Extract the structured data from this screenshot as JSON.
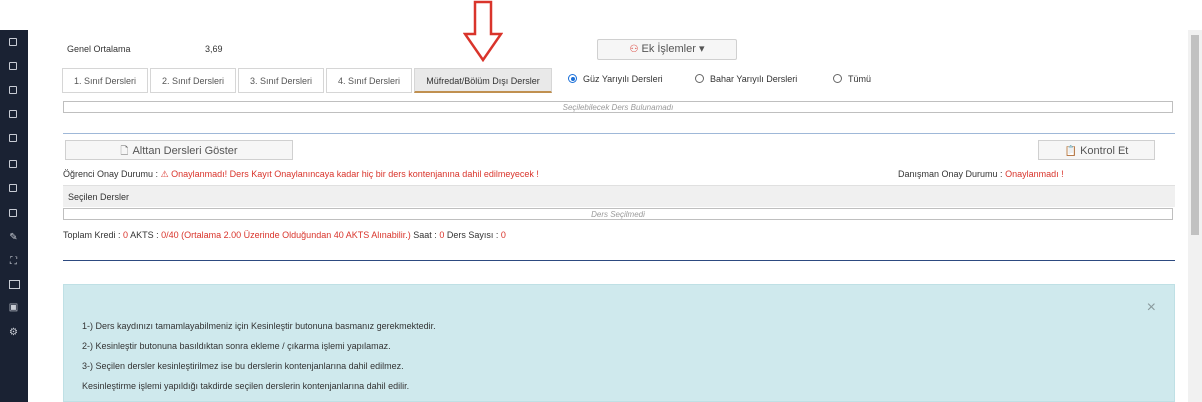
{
  "sidebar": {
    "icons": [
      "square-icon",
      "square-icon",
      "square-icon",
      "square-icon",
      "square-icon",
      "square-icon",
      "square-icon",
      "square-icon",
      "edit-icon",
      "sitemap-icon",
      "ats-icon",
      "id-card-icon",
      "cogs-icon"
    ]
  },
  "summary": {
    "gpa_label": "Genel Ortalama",
    "gpa_value": "3,69",
    "ek_islemler": "Ek İşlemler ▾"
  },
  "tabs": [
    {
      "label": "1. Sınıf Dersleri"
    },
    {
      "label": "2. Sınıf Dersleri"
    },
    {
      "label": "3. Sınıf Dersleri"
    },
    {
      "label": "4. Sınıf Dersleri"
    },
    {
      "label": "Müfredat/Bölüm Dışı Dersler"
    }
  ],
  "semester_filter": {
    "options": [
      "Güz Yarıyılı Dersleri",
      "Bahar Yarıyılı Dersleri",
      "Tümü"
    ],
    "selected": "Güz Yarıyılı Dersleri"
  },
  "available_courses_empty": "Seçilebilecek Ders Bulunamadı",
  "buttons": {
    "show_failed": "Alttan Dersleri Göster",
    "check": "Kontrol Et"
  },
  "approval": {
    "student_label": "Öğrenci Onay Durumu :",
    "student_value": "Onaylanmadı! Ders Kayıt Onaylanıncaya kadar hiç bir ders kontenjanına dahil edilmeyecek !",
    "advisor_label": "Danışman Onay Durumu :",
    "advisor_value": "Onaylanmadı !"
  },
  "selected_courses": {
    "header": "Seçilen Dersler",
    "empty": "Ders Seçilmedi"
  },
  "totals": {
    "kredi_label": "Toplam Kredi :",
    "kredi_value": "0",
    "akts_label": "AKTS :",
    "akts_value": "0/40 (Ortalama 2.00 Üzerinde Olduğundan 40 AKTS Alınabilir.)",
    "saat_label": "Saat :",
    "saat_value": "0",
    "ders_label": "Ders Sayısı :",
    "ders_value": "0"
  },
  "info": {
    "lines": [
      "1-) Ders kaydınızı tamamlayabilmeniz için Kesinleştir butonuna basmanız gerekmektedir.",
      "2-) Kesinleştir butonuna basıldıktan sonra ekleme / çıkarma işlemi yapılamaz.",
      "3-) Seçilen dersler kesinleştirilmez ise bu derslerin kontenjanlarına dahil edilmez.",
      "Kesinleştirme işlemi yapıldığı takdirde seçilen derslerin kontenjanlarına dahil edilir."
    ],
    "close": "×"
  },
  "colors": {
    "sidebar": "#1a2233",
    "danger": "#d9342b",
    "info_bg": "#cfe9ed",
    "arrow": "#d9342b"
  }
}
